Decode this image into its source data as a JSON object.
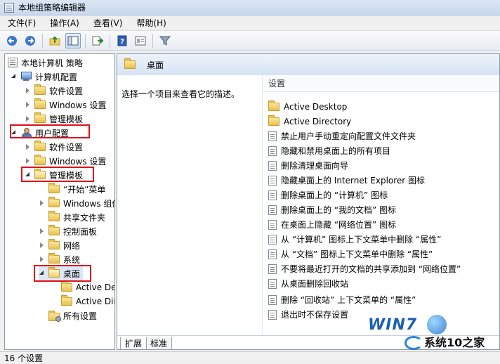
{
  "window": {
    "title": "本地组策略编辑器"
  },
  "menu": [
    "文件(F)",
    "操作(A)",
    "查看(V)",
    "帮助(H)"
  ],
  "toolbar": {
    "buttons": [
      "back-icon",
      "forward-icon",
      "up-folder-icon",
      "show-hide-tree-icon",
      "export-list-icon",
      "help-icon",
      "properties-icon",
      "filter-icon"
    ]
  },
  "tree": {
    "root": "本地计算机 策略",
    "computer_config": "计算机配置",
    "cc_software": "软件设置",
    "cc_windows": "Windows 设置",
    "cc_admin": "管理模板",
    "user_config": "用户配置",
    "uc_software": "软件设置",
    "uc_windows": "Windows 设置",
    "uc_admin": "管理模板",
    "start_menu": "“开始”菜单",
    "windows_components": "Windows 组件",
    "shared_folders": "共享文件夹",
    "control_panel": "控制面板",
    "network": "网络",
    "system": "系统",
    "desktop": "桌面",
    "active_desktop": "Active Desktop",
    "active_directory": "Active Directory",
    "all_settings": "所有设置"
  },
  "content": {
    "header_title": "桌面",
    "description": "选择一个项目来查看它的描述。",
    "column_header": "设置",
    "items": [
      {
        "type": "folder",
        "label": "Active Desktop"
      },
      {
        "type": "folder",
        "label": "Active Directory"
      },
      {
        "type": "setting",
        "label": "禁止用户手动重定向配置文件文件夹"
      },
      {
        "type": "setting",
        "label": "隐藏和禁用桌面上的所有项目"
      },
      {
        "type": "setting",
        "label": "删除清理桌面向导"
      },
      {
        "type": "setting",
        "label": "隐藏桌面上的 Internet Explorer 图标"
      },
      {
        "type": "setting",
        "label": "删除桌面上的 “计算机” 图标"
      },
      {
        "type": "setting",
        "label": "删除桌面上的 “我的文档” 图标"
      },
      {
        "type": "setting",
        "label": "在桌面上隐藏 “网络位置” 图标"
      },
      {
        "type": "setting",
        "label": "从 “计算机” 图标上下文菜单中删除 “属性”"
      },
      {
        "type": "setting",
        "label": "从 “文档” 图标上下文菜单中删除 “属性”"
      },
      {
        "type": "setting",
        "label": "不要将最近打开的文档的共享添加到 “网络位置”"
      },
      {
        "type": "setting",
        "label": "从桌面删除回收站"
      },
      {
        "type": "setting",
        "label": "删除 “回收站” 上下文菜单的 “属性”"
      },
      {
        "type": "setting",
        "label": "退出时不保存设置"
      }
    ]
  },
  "tabs": [
    "扩展",
    "标准"
  ],
  "status": "16 个设置",
  "watermark": {
    "logo": "WIN7",
    "site": "系统10之家"
  },
  "colors": {
    "highlight": "#e0101a",
    "header_bg": "#d6e3f4"
  }
}
